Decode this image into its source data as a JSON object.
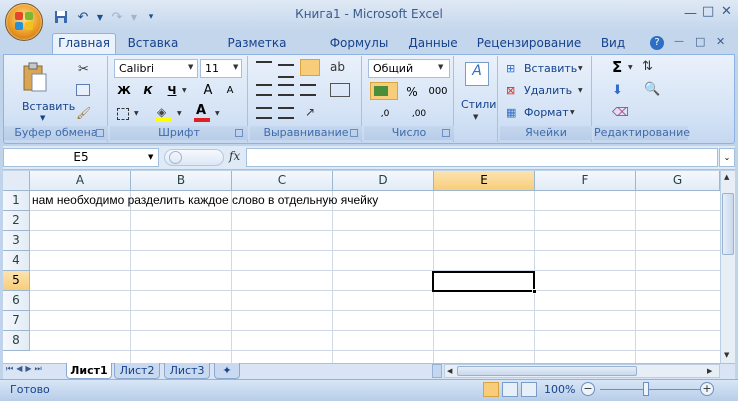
{
  "window": {
    "title": "Книга1 - Microsoft Excel"
  },
  "qat": {
    "save_icon": "save-icon",
    "undo_icon": "undo-icon",
    "redo_icon": "redo-icon",
    "customize_icon": "chevron-down-icon"
  },
  "tabs": [
    {
      "label": "Главная"
    },
    {
      "label": "Вставка"
    },
    {
      "label": "Разметка страницы"
    },
    {
      "label": "Формулы"
    },
    {
      "label": "Данные"
    },
    {
      "label": "Рецензирование"
    },
    {
      "label": "Вид"
    }
  ],
  "ribbon": {
    "clipboard": {
      "label": "Буфер обмена",
      "paste": "Вставить"
    },
    "font": {
      "label": "Шрифт",
      "name": "Calibri",
      "size": "11",
      "bold": "Ж",
      "italic": "К",
      "underline": "Ч",
      "grow": "A",
      "shrink": "A"
    },
    "alignment": {
      "label": "Выравнивание"
    },
    "number": {
      "label": "Число",
      "format": "Общий",
      "percent": "%",
      "thousands": "000",
      "dec_inc": ",0",
      "dec_dec": ",00"
    },
    "styles": {
      "label": "Стили"
    },
    "cells": {
      "label": "Ячейки",
      "insert": "Вставить",
      "delete": "Удалить",
      "format": "Формат"
    },
    "editing": {
      "label": "Редактирование",
      "sum": "Σ"
    }
  },
  "formula_bar": {
    "name_box": "E5",
    "fx": "fx",
    "value": ""
  },
  "sheet": {
    "columns": [
      "A",
      "B",
      "C",
      "D",
      "E",
      "F",
      "G"
    ],
    "rows": [
      "1",
      "2",
      "3",
      "4",
      "5",
      "6",
      "7",
      "8"
    ],
    "cells": {
      "A1": "нам необходимо разделить каждое слово в отдельную ячейку"
    },
    "active_cell": "E5"
  },
  "sheet_tabs": [
    "Лист1",
    "Лист2",
    "Лист3"
  ],
  "status": {
    "ready": "Готово",
    "zoom": "100%",
    "zoom_out": "−",
    "zoom_in": "+"
  },
  "colors": {
    "accent": "#15428b",
    "selection": "#f8cd7a"
  }
}
